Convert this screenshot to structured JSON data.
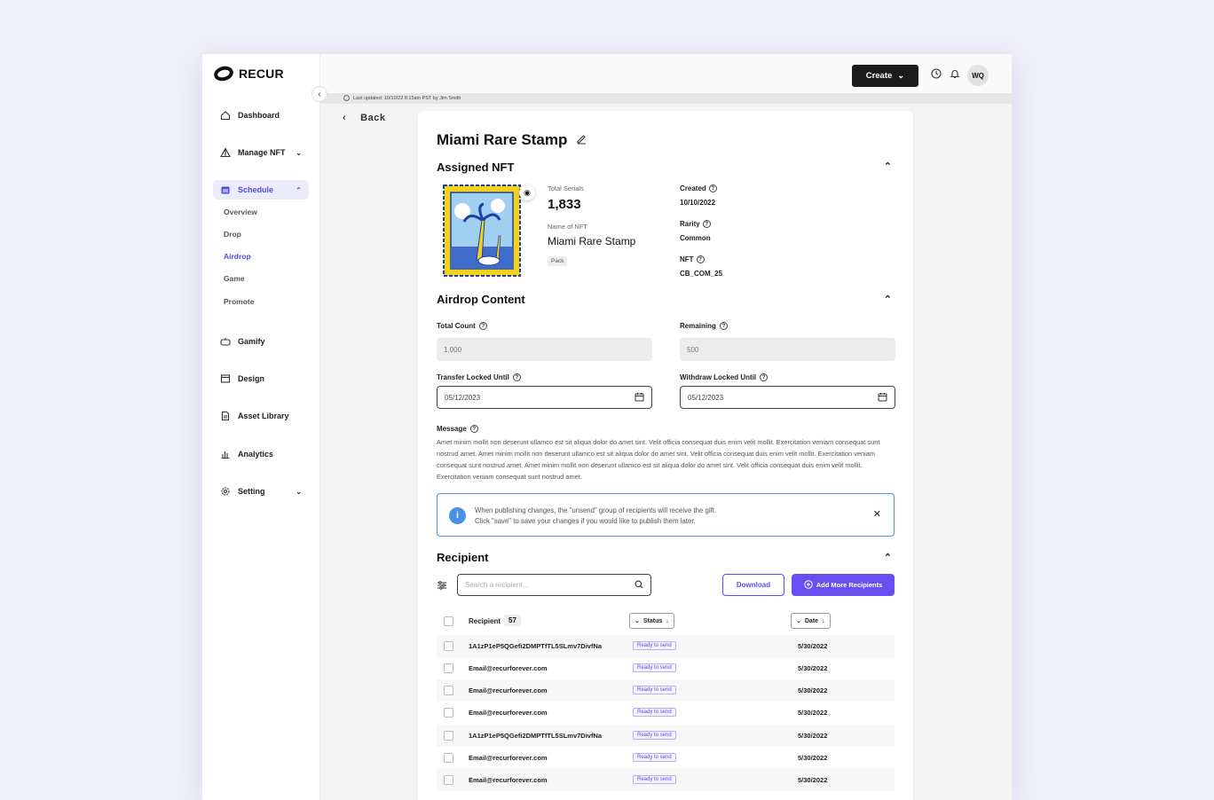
{
  "brand": {
    "name": "RECUR"
  },
  "sidebar": {
    "items": [
      {
        "label": "Dashboard",
        "icon": "home-icon"
      },
      {
        "label": "Manage NFT",
        "icon": "pyramid-icon"
      },
      {
        "label": "Schedule",
        "icon": "calendar-icon"
      },
      {
        "label": "Gamify",
        "icon": "gamepad-icon"
      },
      {
        "label": "Design",
        "icon": "layout-icon"
      },
      {
        "label": "Asset Library",
        "icon": "file-icon"
      },
      {
        "label": "Analytics",
        "icon": "bar-chart-icon"
      },
      {
        "label": "Setting",
        "icon": "gear-icon"
      }
    ],
    "schedule_sub": [
      "Overview",
      "Drop",
      "Airdrop",
      "Game",
      "Promote"
    ],
    "active_sub": "Airdrop"
  },
  "topbar": {
    "create_label": "Create",
    "avatar": "WQ"
  },
  "last_updated": "Last updated: 10/10/22 8:15am PST by Jim Smith",
  "back_label": "Back",
  "page": {
    "title": "Miami Rare Stamp",
    "assigned_nft": {
      "section_title": "Assigned NFT",
      "total_serials_label": "Total Serials",
      "total_serials": "1,833",
      "name_label": "Name of NFT",
      "name": "Miami Rare Stamp",
      "badge": "Pack",
      "created_label": "Created",
      "created": "10/10/2022",
      "rarity_label": "Rarity",
      "rarity": "Common",
      "nft_label": "NFT",
      "nft": "CB_COM_25"
    },
    "airdrop": {
      "section_title": "Airdrop Content",
      "total_count_label": "Total Count",
      "total_count": "1,000",
      "remaining_label": "Remaining",
      "remaining": "500",
      "transfer_label": "Transfer Locked Until",
      "transfer_date": "05/12/2023",
      "withdraw_label": "Withdraw Locked Until",
      "withdraw_date": "05/12/2023",
      "message_label": "Message",
      "message": "Amet minim mollit non deserunt ullamco est sit aliqua dolor do amet sint. Velit officia consequat duis enim velit mollit. Exercitation veniam consequat sunt nostrud amet. Amet minim mollit non deserunt ullamco est sit aliqua dolor do amet sint. Velit officia consequat duis enim velit mollit. Exercitation veniam consequat sunt nostrud amet. Amet minim mollit non deserunt ullamco est sit aliqua dolor do amet sint. Velit officia consequat duis enim velit mollit. Exercitation veniam consequat sunt nostrud amet.",
      "info_line1": "When publishing changes, the \"unsend\" group of recipients will receive the gift.",
      "info_line2": "Click \"save\" to save your changes if you would like to publish them later."
    },
    "recipient": {
      "section_title": "Recipient",
      "search_placeholder": "Search a recipient...",
      "download_label": "Download",
      "add_label": "Add More Recipients",
      "col_recipient": "Recipient",
      "count": "57",
      "col_status": "Status",
      "col_date": "Date",
      "rows": [
        {
          "recipient": "1A1zP1eP5QGefi2DMPTfTL5SLmv7DivfNa",
          "status": "Ready to send",
          "date": "5/30/2022"
        },
        {
          "recipient": "Email@recurforever.com",
          "status": "Ready to send",
          "date": "5/30/2022"
        },
        {
          "recipient": "Email@recurforever.com",
          "status": "Ready to send",
          "date": "5/30/2022"
        },
        {
          "recipient": "Email@recurforever.com",
          "status": "Ready to send",
          "date": "5/30/2022"
        },
        {
          "recipient": "1A1zP1eP5QGefi2DMPTfTL5SLmv7DivfNa",
          "status": "Ready to send",
          "date": "5/30/2022"
        },
        {
          "recipient": "Email@recurforever.com",
          "status": "Ready to send",
          "date": "5/30/2022"
        },
        {
          "recipient": "Email@recurforever.com",
          "status": "Ready to send",
          "date": "5/30/2022"
        }
      ]
    }
  },
  "colors": {
    "accent": "#5b4ee8",
    "info": "#4a90e2",
    "active_nav_bg": "#ebebfb"
  }
}
